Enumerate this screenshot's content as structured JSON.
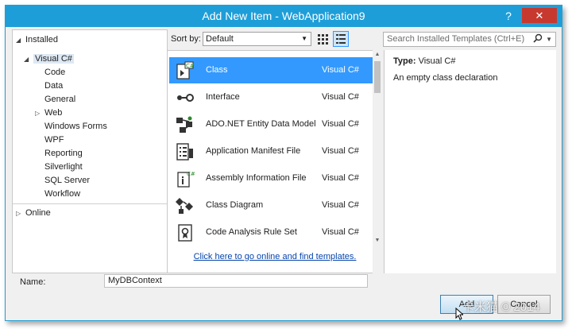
{
  "window": {
    "title": "Add New Item - WebApplication9",
    "help_label": "?",
    "close_label": "✕"
  },
  "tree": {
    "installed": "Installed",
    "visual_csharp": "Visual C#",
    "children": [
      "Code",
      "Data",
      "General",
      "Web",
      "Windows Forms",
      "WPF",
      "Reporting",
      "Silverlight",
      "SQL Server",
      "Workflow"
    ],
    "online": "Online"
  },
  "toolbar": {
    "sort_label": "Sort by:",
    "sort_value": "Default"
  },
  "search": {
    "placeholder": "Search Installed Templates (Ctrl+E)"
  },
  "items": [
    {
      "name": "Class",
      "lang": "Visual C#",
      "icon": "class-icon"
    },
    {
      "name": "Interface",
      "lang": "Visual C#",
      "icon": "interface-icon"
    },
    {
      "name": "ADO.NET Entity Data Model",
      "lang": "Visual C#",
      "icon": "entity-model-icon"
    },
    {
      "name": "Application Manifest File",
      "lang": "Visual C#",
      "icon": "manifest-icon"
    },
    {
      "name": "Assembly Information File",
      "lang": "Visual C#",
      "icon": "assembly-info-icon"
    },
    {
      "name": "Class Diagram",
      "lang": "Visual C#",
      "icon": "class-diagram-icon"
    },
    {
      "name": "Code Analysis Rule Set",
      "lang": "Visual C#",
      "icon": "rule-set-icon"
    }
  ],
  "online_link": "Click here to go online and find templates.",
  "detail": {
    "type_label": "Type:",
    "type_value": "Visual C#",
    "description": "An empty class declaration"
  },
  "name_field": {
    "label": "Name:",
    "value": "MyDBContext"
  },
  "buttons": {
    "add": "Add",
    "cancel": "Cancel"
  },
  "watermark": "卡米猫 © 2014",
  "colors": {
    "title_bar": "#1e9ed8",
    "close_button": "#c7392f",
    "selection": "#3399ff"
  }
}
